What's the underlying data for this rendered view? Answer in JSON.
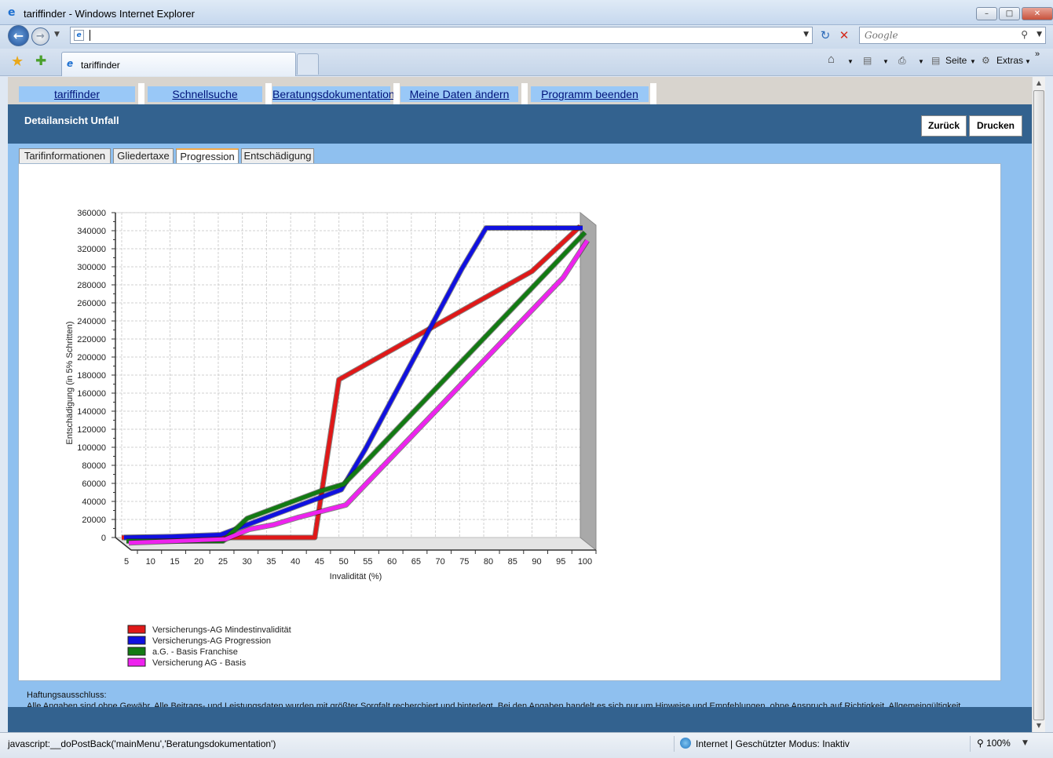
{
  "window": {
    "title": "tariffinder - Windows Internet Explorer",
    "tab_label": "tariffinder",
    "search_placeholder": "Google",
    "commands": {
      "page": "Seite",
      "tools": "Extras"
    }
  },
  "menu": {
    "items": [
      "tariffinder",
      "Schnellsuche",
      "Beratungsdokumentation",
      "Meine Daten ändern",
      "Programm beenden"
    ]
  },
  "header": {
    "title": "Detailansicht Unfall",
    "back_label": "Zurück",
    "print_label": "Drucken"
  },
  "tabs": [
    "Tarifinformationen",
    "Gliedertaxe",
    "Progression",
    "Entschädigung"
  ],
  "active_tab": "Progression",
  "chart_data": {
    "type": "line",
    "xlabel": "Invalidität (%)",
    "ylabel": "Entschädigung (in 5% Schritten)",
    "x": [
      5,
      10,
      15,
      20,
      25,
      30,
      35,
      40,
      45,
      50,
      55,
      60,
      65,
      70,
      75,
      80,
      85,
      90,
      95,
      100
    ],
    "y_ticks": [
      0,
      20000,
      40000,
      60000,
      80000,
      100000,
      120000,
      140000,
      160000,
      180000,
      200000,
      220000,
      240000,
      260000,
      280000,
      300000,
      320000,
      340000,
      360000
    ],
    "ylim": [
      0,
      360000
    ],
    "grid": true,
    "legend_position": "bottom-left",
    "series": [
      {
        "name": "Versicherungs-AG Mindestinvalidität",
        "color": "#e01818",
        "values": [
          0,
          0,
          0,
          0,
          0,
          0,
          0,
          0,
          0,
          175000,
          190000,
          205000,
          220000,
          235000,
          250000,
          265000,
          280000,
          295000,
          320000,
          345000
        ]
      },
      {
        "name": "Versicherungs-AG Progression",
        "color": "#1010e0",
        "values": [
          2000,
          2500,
          3000,
          4000,
          5000,
          15000,
          25000,
          35000,
          45000,
          55000,
          100000,
          150000,
          200000,
          250000,
          300000,
          345000,
          345000,
          345000,
          345000,
          345000
        ]
      },
      {
        "name": "a.G. - Basis Franchise",
        "color": "#127a12",
        "values": [
          0,
          0,
          0,
          0,
          0,
          25000,
          35000,
          45000,
          55000,
          63000,
          90000,
          118000,
          146000,
          174000,
          202000,
          230000,
          258000,
          286000,
          314000,
          342000
        ]
      },
      {
        "name": "Versicherung AG - Basis",
        "color": "#ee22ee",
        "values": [
          0,
          1000,
          2000,
          3000,
          4000,
          15000,
          20000,
          28000,
          35000,
          42000,
          70000,
          98000,
          126000,
          154000,
          182000,
          210000,
          238000,
          266000,
          294000,
          335000
        ]
      }
    ]
  },
  "disclaimer": {
    "title": "Haftungsausschluss:",
    "text": "Alle Angaben sind ohne Gewähr. Alle Beitrags- und Leistungsdaten wurden mit größter Sorgfalt recherchiert und hinterlegt. Bei den Angaben handelt es sich nur um Hinweise und Empfehlungen, ohne Anspruch auf Richtigkeit, Allgemeingültigkeit"
  },
  "status": {
    "text": "javascript:__doPostBack('mainMenu','Beratungsdokumentation')",
    "zone": "Internet | Geschützter Modus: Inaktiv",
    "zoom": "100%"
  },
  "icons": [
    "back-arrow-icon",
    "forward-arrow-icon",
    "refresh-icon",
    "stop-icon",
    "search-icon",
    "favorites-star-icon",
    "add-favorites-icon",
    "home-icon",
    "feeds-icon",
    "print-icon",
    "gear-icon",
    "globe-icon",
    "zoom-icon"
  ]
}
